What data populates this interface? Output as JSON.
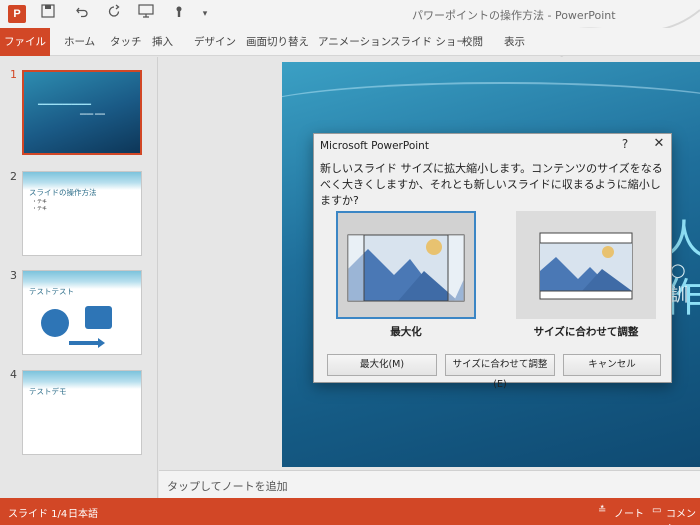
{
  "window": {
    "title": "パワーポイントの操作方法 - PowerPoint",
    "app_icon": "P"
  },
  "quick_access": {
    "icons": [
      "save-icon",
      "undo-icon",
      "redo-icon",
      "slideshow-icon",
      "touch-mode-icon",
      "customize-icon"
    ]
  },
  "ribbon": {
    "tabs": [
      "ファイル",
      "ホーム",
      "タッチ",
      "挿入",
      "デザイン",
      "画面切り替え",
      "アニメーション",
      "スライド ショー",
      "校閲",
      "表示"
    ]
  },
  "thumbnails": [
    {
      "number": "1",
      "title": ""
    },
    {
      "number": "2",
      "title": "スライドの操作方法",
      "bullets": [
        "・テキ",
        "・テキ"
      ]
    },
    {
      "number": "3",
      "title": "テストテスト"
    },
    {
      "number": "4",
      "title": "テストデモ"
    }
  ],
  "slide": {
    "big_title": "人作",
    "subtitle": "○訓"
  },
  "notes": {
    "placeholder": "タップしてノートを追加"
  },
  "status": {
    "slide_indicator": "スライド 1/4",
    "language": "日本語",
    "notes_label": "ノート",
    "comments_label": "コメント"
  },
  "dialog": {
    "title": "Microsoft PowerPoint",
    "help": "?",
    "close": "✕",
    "message": "新しいスライド サイズに拡大縮小します。コンテンツのサイズをなるべく大きくしますか、それとも新しいスライドに収まるように縮小しますか?",
    "options": [
      {
        "label": "最大化",
        "selected": true
      },
      {
        "label": "サイズに合わせて調整",
        "selected": false
      }
    ],
    "buttons": [
      "最大化(M)",
      "サイズに合わせて調整(E)",
      "キャンセル"
    ]
  },
  "colors": {
    "accent": "#d24726",
    "selection": "#3b86c5",
    "image_blue": "#4a78b5",
    "sun": "#e8c270"
  }
}
